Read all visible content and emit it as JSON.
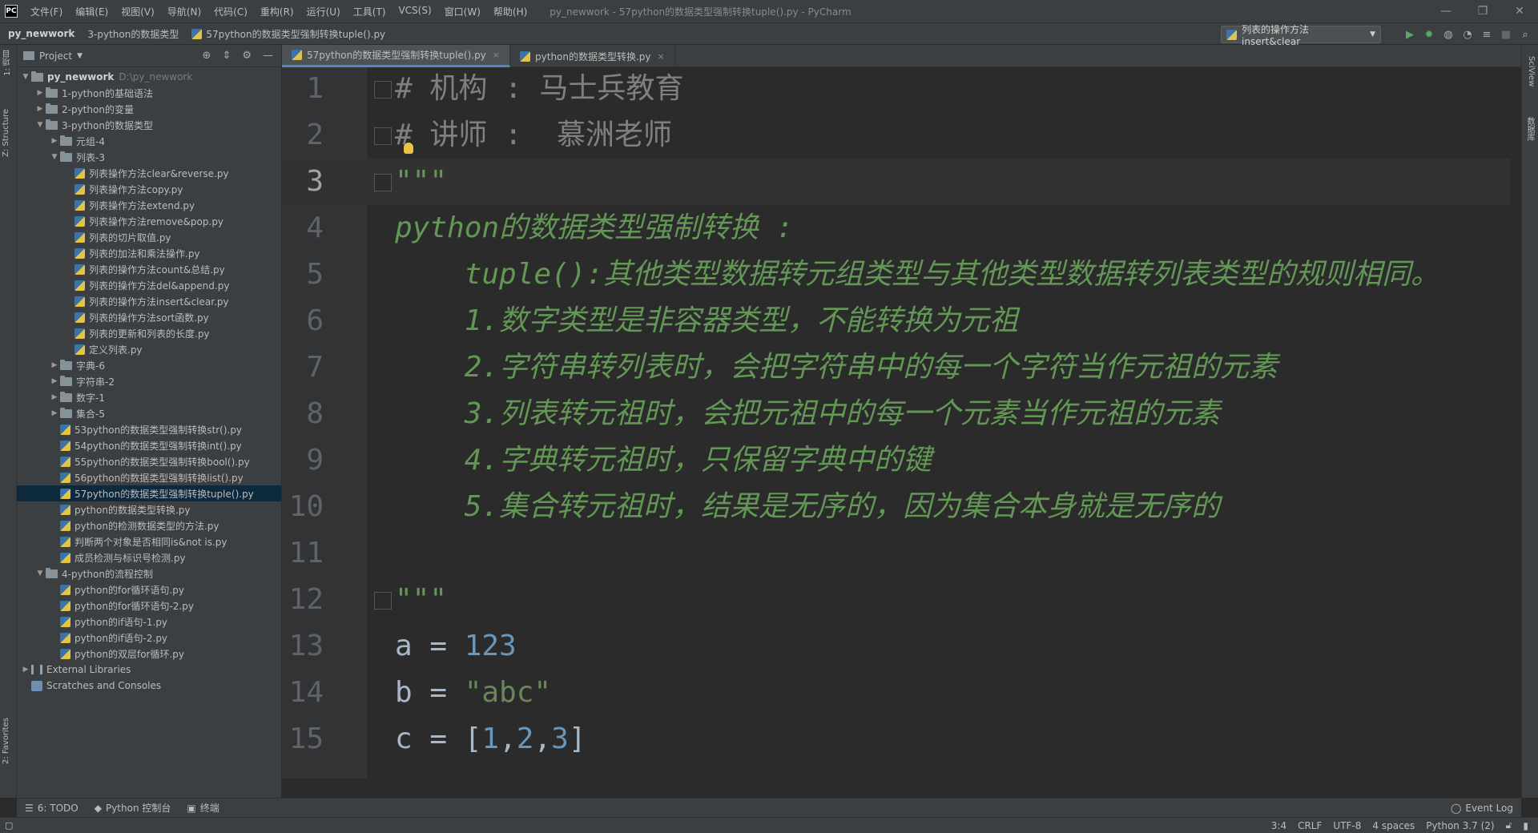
{
  "menubar": {
    "items": [
      "文件(F)",
      "编辑(E)",
      "视图(V)",
      "导航(N)",
      "代码(C)",
      "重构(R)",
      "运行(U)",
      "工具(T)",
      "VCS(S)",
      "窗口(W)",
      "帮助(H)"
    ],
    "window_title": "py_newwork - 57python的数据类型强制转换tuple().py - PyCharm"
  },
  "navbar": {
    "crumbs": [
      "py_newwork",
      "3-python的数据类型",
      "57python的数据类型强制转换tuple().py"
    ],
    "run_config": "列表的操作方法insert&clear"
  },
  "left_strip": {
    "project_tab": "1: 项目",
    "structure_tab": "Z: Structure",
    "favorites_tab": "2: Favorites"
  },
  "right_strip": {
    "sciview_tab": "SciView",
    "database_tab": "数据库"
  },
  "project": {
    "title": "Project",
    "tree": [
      {
        "label": "py_newwork",
        "hint": "D:\\py_newwork",
        "depth": 0,
        "type": "folder",
        "arrow": "open",
        "bold": true
      },
      {
        "label": "1-python的基础语法",
        "depth": 1,
        "type": "folder",
        "arrow": "closed"
      },
      {
        "label": "2-python的变量",
        "depth": 1,
        "type": "folder",
        "arrow": "closed"
      },
      {
        "label": "3-python的数据类型",
        "depth": 1,
        "type": "folder",
        "arrow": "open"
      },
      {
        "label": "元组-4",
        "depth": 2,
        "type": "folder",
        "arrow": "closed"
      },
      {
        "label": "列表-3",
        "depth": 2,
        "type": "folder",
        "arrow": "open"
      },
      {
        "label": "列表操作方法clear&reverse.py",
        "depth": 3,
        "type": "py"
      },
      {
        "label": "列表操作方法copy.py",
        "depth": 3,
        "type": "py"
      },
      {
        "label": "列表操作方法extend.py",
        "depth": 3,
        "type": "py"
      },
      {
        "label": "列表操作方法remove&pop.py",
        "depth": 3,
        "type": "py"
      },
      {
        "label": "列表的切片取值.py",
        "depth": 3,
        "type": "py"
      },
      {
        "label": "列表的加法和乘法操作.py",
        "depth": 3,
        "type": "py"
      },
      {
        "label": "列表的操作方法count&总结.py",
        "depth": 3,
        "type": "py"
      },
      {
        "label": "列表的操作方法del&append.py",
        "depth": 3,
        "type": "py"
      },
      {
        "label": "列表的操作方法insert&clear.py",
        "depth": 3,
        "type": "py"
      },
      {
        "label": "列表的操作方法sort函数.py",
        "depth": 3,
        "type": "py"
      },
      {
        "label": "列表的更新和列表的长度.py",
        "depth": 3,
        "type": "py"
      },
      {
        "label": "定义列表.py",
        "depth": 3,
        "type": "py"
      },
      {
        "label": "字典-6",
        "depth": 2,
        "type": "folder",
        "arrow": "closed"
      },
      {
        "label": "字符串-2",
        "depth": 2,
        "type": "folder",
        "arrow": "closed"
      },
      {
        "label": "数字-1",
        "depth": 2,
        "type": "folder",
        "arrow": "closed"
      },
      {
        "label": "集合-5",
        "depth": 2,
        "type": "folder",
        "arrow": "closed"
      },
      {
        "label": "53python的数据类型强制转换str().py",
        "depth": 2,
        "type": "py"
      },
      {
        "label": "54python的数据类型强制转换int().py",
        "depth": 2,
        "type": "py"
      },
      {
        "label": "55python的数据类型强制转换bool().py",
        "depth": 2,
        "type": "py"
      },
      {
        "label": "56python的数据类型强制转换list().py",
        "depth": 2,
        "type": "py"
      },
      {
        "label": "57python的数据类型强制转换tuple().py",
        "depth": 2,
        "type": "py",
        "selected": true
      },
      {
        "label": "python的数据类型转换.py",
        "depth": 2,
        "type": "py"
      },
      {
        "label": "python的检测数据类型的方法.py",
        "depth": 2,
        "type": "py"
      },
      {
        "label": "判断两个对象是否相同is&not is.py",
        "depth": 2,
        "type": "py"
      },
      {
        "label": "成员检测与标识号检测.py",
        "depth": 2,
        "type": "py"
      },
      {
        "label": "4-python的流程控制",
        "depth": 1,
        "type": "folder",
        "arrow": "open"
      },
      {
        "label": "python的for循环语句.py",
        "depth": 2,
        "type": "py"
      },
      {
        "label": "python的for循环语句-2.py",
        "depth": 2,
        "type": "py"
      },
      {
        "label": "python的if语句-1.py",
        "depth": 2,
        "type": "py"
      },
      {
        "label": "python的if语句-2.py",
        "depth": 2,
        "type": "py"
      },
      {
        "label": "python的双层for循环.py",
        "depth": 2,
        "type": "py"
      },
      {
        "label": "External Libraries",
        "depth": 0,
        "type": "lib",
        "arrow": "closed"
      },
      {
        "label": "Scratches and Consoles",
        "depth": 0,
        "type": "scratch"
      }
    ]
  },
  "tabs": [
    {
      "label": "57python的数据类型强制转换tuple().py",
      "active": true
    },
    {
      "label": "python的数据类型转换.py",
      "active": false
    }
  ],
  "editor": {
    "current_line": 3,
    "lines": [
      [
        {
          "t": "# 机构 : 马士兵教育",
          "c": "cm"
        }
      ],
      [
        {
          "t": "# 讲师 :  慕洲老师",
          "c": "cm"
        }
      ],
      [
        {
          "t": "\"\"\"",
          "c": "doc"
        }
      ],
      [
        {
          "t": "python的数据类型强制转换 :",
          "c": "doc"
        }
      ],
      [
        {
          "t": "    tuple():其他类型数据转元组类型与其他类型数据转列表类型的规则相同。",
          "c": "doc"
        }
      ],
      [
        {
          "t": "    1.数字类型是非容器类型，不能转换为元祖",
          "c": "doc"
        }
      ],
      [
        {
          "t": "    2.字符串转列表时，会把字符串中的每一个字符当作元祖的元素",
          "c": "doc"
        }
      ],
      [
        {
          "t": "    3.列表转元祖时，会把元祖中的每一个元素当作元祖的元素",
          "c": "doc"
        }
      ],
      [
        {
          "t": "    4.字典转元祖时，只保留字典中的键",
          "c": "doc"
        }
      ],
      [
        {
          "t": "    5.集合转元祖时，结果是无序的，因为集合本身就是无序的",
          "c": "doc"
        }
      ],
      [],
      [
        {
          "t": "\"\"\"",
          "c": "doc"
        }
      ],
      [
        {
          "t": "a = ",
          "c": ""
        },
        {
          "t": "123",
          "c": "num"
        }
      ],
      [
        {
          "t": "b = ",
          "c": ""
        },
        {
          "t": "\"abc\"",
          "c": "str"
        }
      ],
      [
        {
          "t": "c = [",
          "c": ""
        },
        {
          "t": "1",
          "c": "num"
        },
        {
          "t": ",",
          "c": ""
        },
        {
          "t": "2",
          "c": "num"
        },
        {
          "t": ",",
          "c": ""
        },
        {
          "t": "3",
          "c": "num"
        },
        {
          "t": "]",
          "c": ""
        }
      ]
    ]
  },
  "bottom_tabs": [
    "6: TODO",
    "Python 控制台",
    "终端"
  ],
  "event_log": "Event Log",
  "status": {
    "position": "3:4",
    "line_sep": "CRLF",
    "encoding": "UTF-8",
    "indent": "4 spaces",
    "interpreter": "Python 3.7 (2)"
  }
}
